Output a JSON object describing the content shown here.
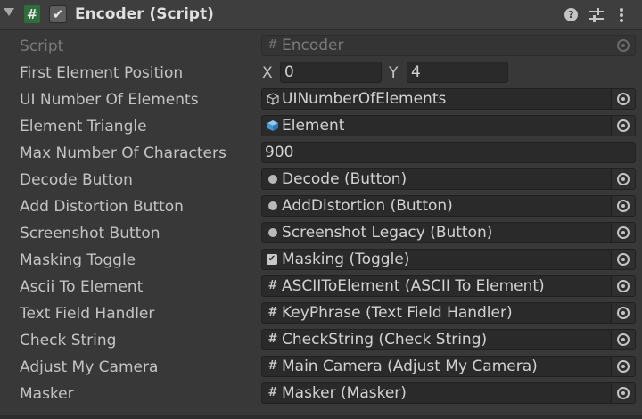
{
  "component": {
    "title": "Encoder (Script)",
    "script_icon": "#",
    "enabled_check": "✔",
    "icons": [
      "foldout-arrow-icon",
      "script-icon",
      "help-icon",
      "settings-icon",
      "menu-icon"
    ]
  },
  "script_row": {
    "label": "Script",
    "value": "Encoder"
  },
  "first_element_position": {
    "label": "First Element Position",
    "x_label": "X",
    "x_value": "0",
    "y_label": "Y",
    "y_value": "4"
  },
  "ui_number": {
    "label": "UI Number Of Elements",
    "value": "UINumberOfElements"
  },
  "element_triangle": {
    "label": "Element Triangle",
    "value": "Element"
  },
  "max_chars": {
    "label": "Max Number Of Characters",
    "value": "900"
  },
  "fields": [
    {
      "label": "Decode Button",
      "value": "Decode (Button)",
      "icon": "button-icon"
    },
    {
      "label": "Add Distortion Button",
      "value": "AddDistortion (Button)",
      "icon": "button-icon"
    },
    {
      "label": "Screenshot Button",
      "value": "Screenshot Legacy (Button)",
      "icon": "button-icon"
    },
    {
      "label": "Masking Toggle",
      "value": "Masking (Toggle)",
      "icon": "toggle-icon"
    },
    {
      "label": "Ascii To Element",
      "value": "ASCIIToElement (ASCII To Element)",
      "icon": "script-icon"
    },
    {
      "label": "Text Field Handler",
      "value": "KeyPhrase (Text Field Handler)",
      "icon": "script-icon"
    },
    {
      "label": "Check String",
      "value": "CheckString (Check String)",
      "icon": "script-icon"
    },
    {
      "label": "Adjust My Camera",
      "value": "Main Camera (Adjust My Camera)",
      "icon": "script-icon"
    },
    {
      "label": "Masker",
      "value": "Masker (Masker)",
      "icon": "script-icon"
    }
  ]
}
